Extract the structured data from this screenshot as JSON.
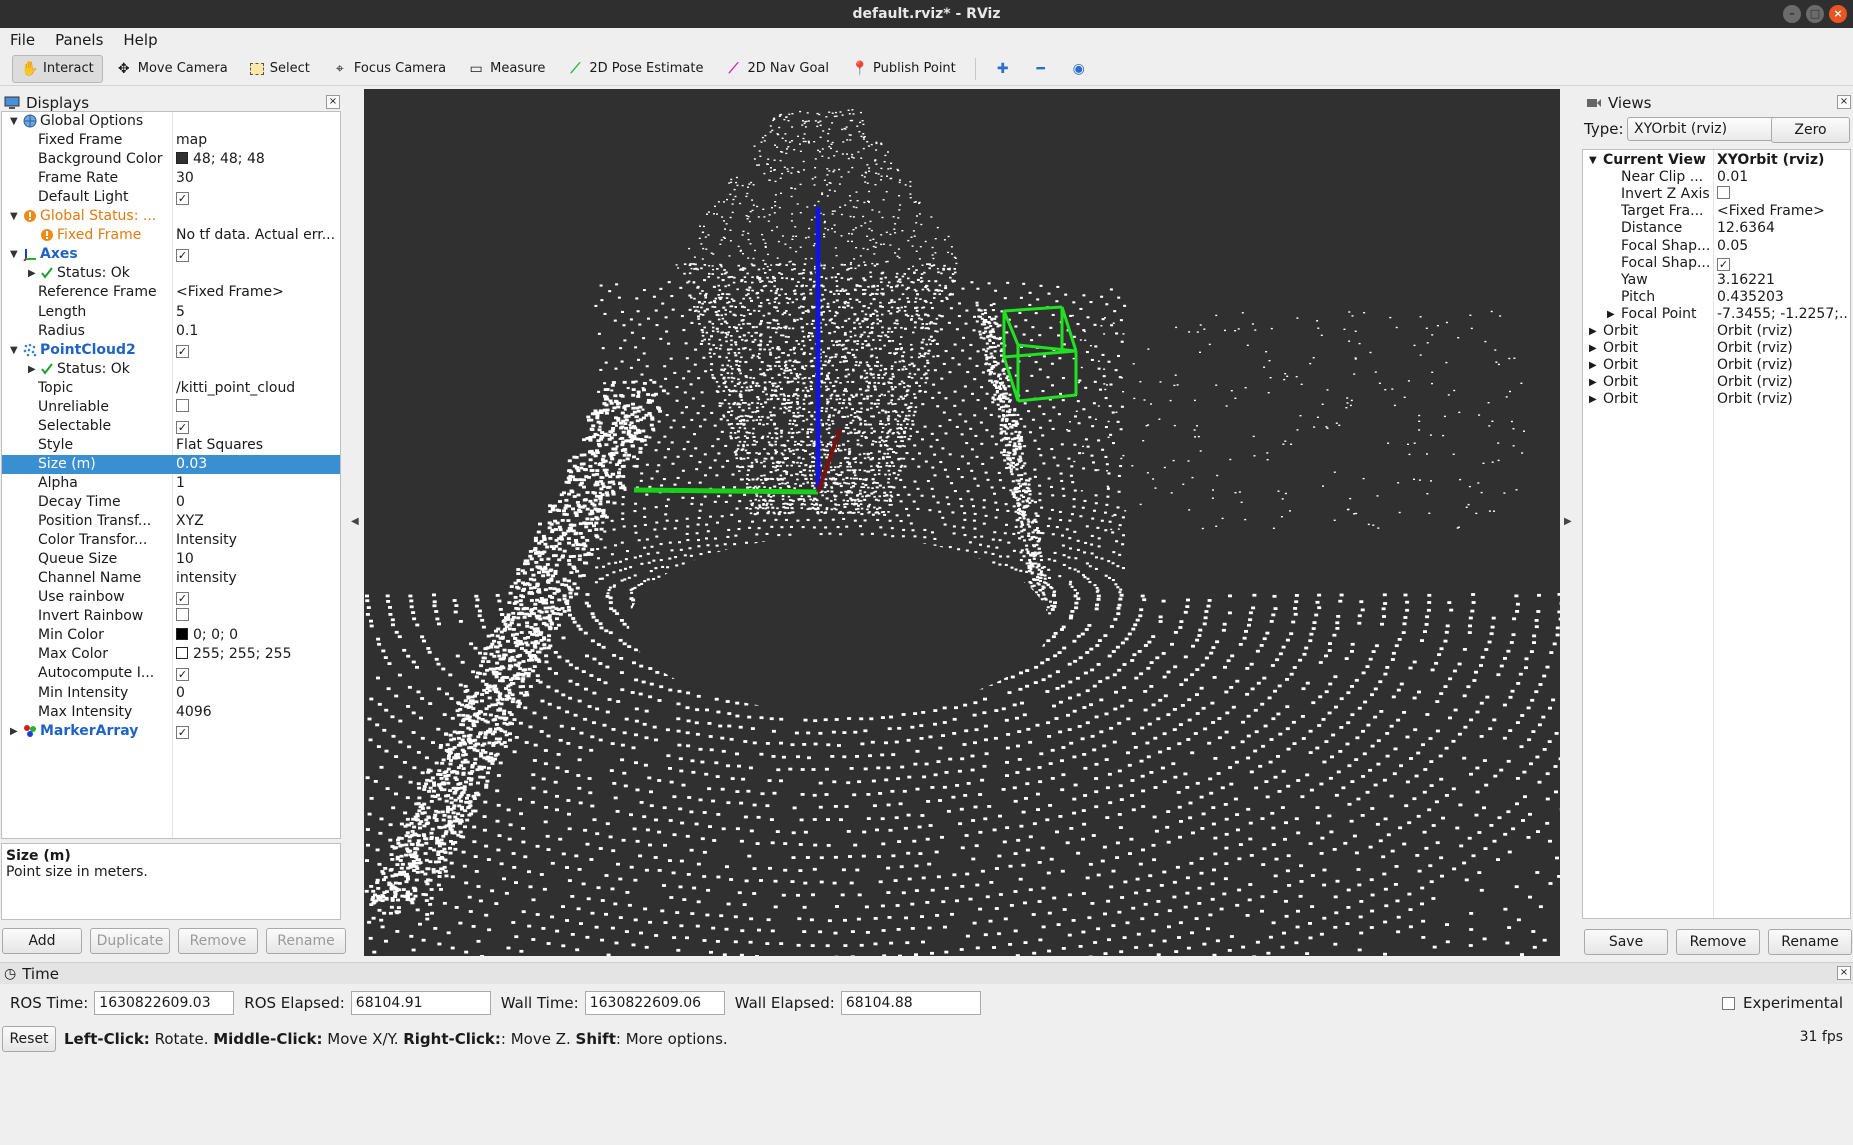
{
  "window": {
    "title": "default.rviz* - RViz"
  },
  "menu": [
    "File",
    "Panels",
    "Help"
  ],
  "toolbar": {
    "tools": [
      {
        "label": "Interact",
        "icon": "hand-icon",
        "active": true
      },
      {
        "label": "Move Camera",
        "icon": "move-camera-icon"
      },
      {
        "label": "Select",
        "icon": "select-icon"
      },
      {
        "label": "Focus Camera",
        "icon": "focus-camera-icon"
      },
      {
        "label": "Measure",
        "icon": "measure-icon"
      },
      {
        "label": "2D Pose Estimate",
        "icon": "pose-estimate-icon"
      },
      {
        "label": "2D Nav Goal",
        "icon": "nav-goal-icon"
      },
      {
        "label": "Publish Point",
        "icon": "publish-point-icon"
      }
    ]
  },
  "displays": {
    "title": "Displays",
    "rows": [
      {
        "name": "Global Options",
        "value": "",
        "arrow": "down",
        "icon": "globe",
        "indent": 0,
        "style": ""
      },
      {
        "name": "Fixed Frame",
        "value": "map",
        "indent": 1
      },
      {
        "name": "Background Color",
        "value": "48; 48; 48",
        "swatch": "#303030",
        "indent": 1
      },
      {
        "name": "Frame Rate",
        "value": "30",
        "indent": 1
      },
      {
        "name": "Default Light",
        "value": "",
        "check": true,
        "indent": 1
      },
      {
        "name": "Global Status: ...",
        "value": "",
        "arrow": "down",
        "icon": "warn",
        "indent": 0,
        "style": "orange"
      },
      {
        "name": "Fixed Frame",
        "value": "No tf data.  Actual err...",
        "icon": "warn",
        "indent": 1,
        "style": "orange"
      },
      {
        "name": "Axes",
        "value": "",
        "check": true,
        "arrow": "down",
        "icon": "axes",
        "indent": 0,
        "style": "blue"
      },
      {
        "name": "Status: Ok",
        "value": "",
        "arrow": "right",
        "icon": "ok",
        "indent": 1
      },
      {
        "name": "Reference Frame",
        "value": "<Fixed Frame>",
        "indent": 1
      },
      {
        "name": "Length",
        "value": "5",
        "indent": 1
      },
      {
        "name": "Radius",
        "value": "0.1",
        "indent": 1
      },
      {
        "name": "PointCloud2",
        "value": "",
        "check": true,
        "arrow": "down",
        "icon": "cloud",
        "indent": 0,
        "style": "blue"
      },
      {
        "name": "Status: Ok",
        "value": "",
        "arrow": "right",
        "icon": "ok",
        "indent": 1
      },
      {
        "name": "Topic",
        "value": "/kitti_point_cloud",
        "indent": 1
      },
      {
        "name": "Unreliable",
        "value": "",
        "check": false,
        "indent": 1
      },
      {
        "name": "Selectable",
        "value": "",
        "check": true,
        "indent": 1
      },
      {
        "name": "Style",
        "value": "Flat Squares",
        "indent": 1
      },
      {
        "name": "Size (m)",
        "value": "0.03",
        "indent": 1,
        "selected": true
      },
      {
        "name": "Alpha",
        "value": "1",
        "indent": 1
      },
      {
        "name": "Decay Time",
        "value": "0",
        "indent": 1
      },
      {
        "name": "Position Transf...",
        "value": "XYZ",
        "indent": 1
      },
      {
        "name": "Color Transfor...",
        "value": "Intensity",
        "indent": 1
      },
      {
        "name": "Queue Size",
        "value": "10",
        "indent": 1
      },
      {
        "name": "Channel Name",
        "value": "intensity",
        "indent": 1
      },
      {
        "name": "Use rainbow",
        "value": "",
        "check": true,
        "indent": 1
      },
      {
        "name": "Invert Rainbow",
        "value": "",
        "check": false,
        "indent": 1
      },
      {
        "name": "Min Color",
        "value": "0; 0; 0",
        "swatch": "#000000",
        "indent": 1
      },
      {
        "name": "Max Color",
        "value": "255; 255; 255",
        "swatch": "#ffffff",
        "indent": 1
      },
      {
        "name": "Autocompute I...",
        "value": "",
        "check": true,
        "indent": 1
      },
      {
        "name": "Min Intensity",
        "value": "0",
        "indent": 1
      },
      {
        "name": "Max Intensity",
        "value": "4096",
        "indent": 1
      },
      {
        "name": "MarkerArray",
        "value": "",
        "check": true,
        "arrow": "right",
        "icon": "marker",
        "indent": 0,
        "style": "blue"
      }
    ],
    "description": {
      "title": "Size (m)",
      "text": "Point size in meters."
    },
    "buttons": [
      {
        "label": "Add",
        "enabled": true
      },
      {
        "label": "Duplicate",
        "enabled": false
      },
      {
        "label": "Remove",
        "enabled": false
      },
      {
        "label": "Rename",
        "enabled": false
      }
    ]
  },
  "views": {
    "title": "Views",
    "type_label": "Type:",
    "type_value": "XYOrbit (rviz)",
    "zero_label": "Zero",
    "rows": [
      {
        "name": "Current View",
        "value": "XYOrbit (rviz)",
        "arrow": "down",
        "indent": 0,
        "bold": true
      },
      {
        "name": "Near Clip ...",
        "value": "0.01",
        "indent": 1
      },
      {
        "name": "Invert Z Axis",
        "value": "",
        "check": false,
        "indent": 1
      },
      {
        "name": "Target Fra...",
        "value": "<Fixed Frame>",
        "indent": 1
      },
      {
        "name": "Distance",
        "value": "12.6364",
        "indent": 1
      },
      {
        "name": "Focal Shap...",
        "value": "0.05",
        "indent": 1
      },
      {
        "name": "Focal Shap...",
        "value": "",
        "check": true,
        "indent": 1
      },
      {
        "name": "Yaw",
        "value": "3.16221",
        "indent": 1
      },
      {
        "name": "Pitch",
        "value": "0.435203",
        "indent": 1
      },
      {
        "name": "Focal Point",
        "value": "-7.3455; -1.2257;...",
        "arrow": "right",
        "indent": 1
      },
      {
        "name": "Orbit",
        "value": "Orbit (rviz)",
        "arrow": "right",
        "indent": 0
      },
      {
        "name": "Orbit",
        "value": "Orbit (rviz)",
        "arrow": "right",
        "indent": 0
      },
      {
        "name": "Orbit",
        "value": "Orbit (rviz)",
        "arrow": "right",
        "indent": 0
      },
      {
        "name": "Orbit",
        "value": "Orbit (rviz)",
        "arrow": "right",
        "indent": 0
      },
      {
        "name": "Orbit",
        "value": "Orbit (rviz)",
        "arrow": "right",
        "indent": 0
      }
    ],
    "buttons": [
      "Save",
      "Remove",
      "Rename"
    ]
  },
  "time": {
    "title": "Time",
    "ros_time_label": "ROS Time:",
    "ros_time": "1630822609.03",
    "ros_elapsed_label": "ROS Elapsed:",
    "ros_elapsed": "68104.91",
    "wall_time_label": "Wall Time:",
    "wall_time": "1630822609.06",
    "wall_elapsed_label": "Wall Elapsed:",
    "wall_elapsed": "68104.88",
    "experimental_label": "Experimental"
  },
  "statusbar": {
    "reset_label": "Reset",
    "hint_parts": [
      {
        "text": "Left-Click:",
        "bold": true
      },
      {
        "text": " Rotate. ",
        "bold": false
      },
      {
        "text": "Middle-Click:",
        "bold": true
      },
      {
        "text": " Move X/Y. ",
        "bold": false
      },
      {
        "text": "Right-Click:",
        "bold": true
      },
      {
        "text": ": Move Z. ",
        "bold": false
      },
      {
        "text": "Shift",
        "bold": true
      },
      {
        "text": ": More options.",
        "bold": false
      }
    ],
    "fps": "31 fps"
  }
}
